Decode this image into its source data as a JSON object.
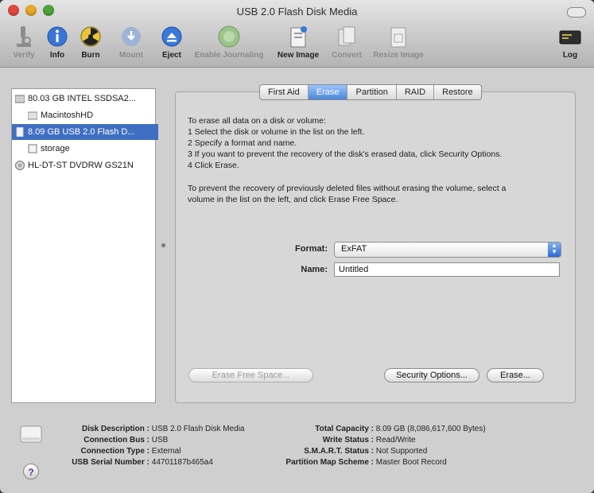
{
  "window": {
    "title": "USB 2.0 Flash Disk Media"
  },
  "toolbar": {
    "items": [
      {
        "label": "Verify",
        "enabled": false
      },
      {
        "label": "Info",
        "enabled": true
      },
      {
        "label": "Burn",
        "enabled": true
      },
      {
        "label": "Mount",
        "enabled": false
      },
      {
        "label": "Eject",
        "enabled": true
      },
      {
        "label": "Enable Journaling",
        "enabled": false
      },
      {
        "label": "New Image",
        "enabled": true
      },
      {
        "label": "Convert",
        "enabled": false
      },
      {
        "label": "Resize Image",
        "enabled": false
      }
    ],
    "log": {
      "label": "Log"
    }
  },
  "sidebar": {
    "items": [
      {
        "label": "80.03 GB INTEL SSDSA2...",
        "level": 0,
        "kind": "drive"
      },
      {
        "label": "MacintoshHD",
        "level": 1,
        "kind": "volume"
      },
      {
        "label": "8.09 GB USB 2.0 Flash D...",
        "level": 0,
        "kind": "drive",
        "selected": true
      },
      {
        "label": "storage",
        "level": 1,
        "kind": "volume"
      },
      {
        "label": "HL-DT-ST DVDRW GS21N",
        "level": 0,
        "kind": "optical"
      }
    ]
  },
  "tabs": [
    {
      "label": "First Aid"
    },
    {
      "label": "Erase",
      "active": true
    },
    {
      "label": "Partition"
    },
    {
      "label": "RAID"
    },
    {
      "label": "Restore"
    }
  ],
  "erase": {
    "instructions": [
      "To erase all data on a disk or volume:",
      "1 Select the disk or volume in the list on the left.",
      "2 Specify a format and name.",
      "3 If you want to prevent the recovery of the disk's erased data, click Security Options.",
      "4 Click Erase."
    ],
    "free_space_text_1": "To prevent the recovery of previously deleted files without erasing the volume, select a",
    "free_space_text_2": "volume in the list on the left, and click Erase Free Space.",
    "format_label": "Format:",
    "format_value": "ExFAT",
    "name_label": "Name:",
    "name_value": "Untitled",
    "erase_free_space_label": "Erase Free Space...",
    "security_options_label": "Security Options...",
    "erase_label": "Erase..."
  },
  "info": {
    "left": [
      {
        "key": "Disk Description :",
        "value": "USB 2.0 Flash Disk Media"
      },
      {
        "key": "Connection Bus :",
        "value": "USB"
      },
      {
        "key": "Connection Type :",
        "value": "External"
      },
      {
        "key": "USB Serial Number :",
        "value": "44701187b465a4"
      }
    ],
    "right": [
      {
        "key": "Total Capacity :",
        "value": "8.09 GB (8,086,617,600 Bytes)"
      },
      {
        "key": "Write Status :",
        "value": "Read/Write"
      },
      {
        "key": "S.M.A.R.T. Status :",
        "value": "Not Supported"
      },
      {
        "key": "Partition Map Scheme :",
        "value": "Master Boot Record"
      }
    ]
  },
  "help": {
    "label": "?"
  },
  "colors": {
    "selection": "#3f6fc2",
    "tab_active": "#4b86d8"
  }
}
